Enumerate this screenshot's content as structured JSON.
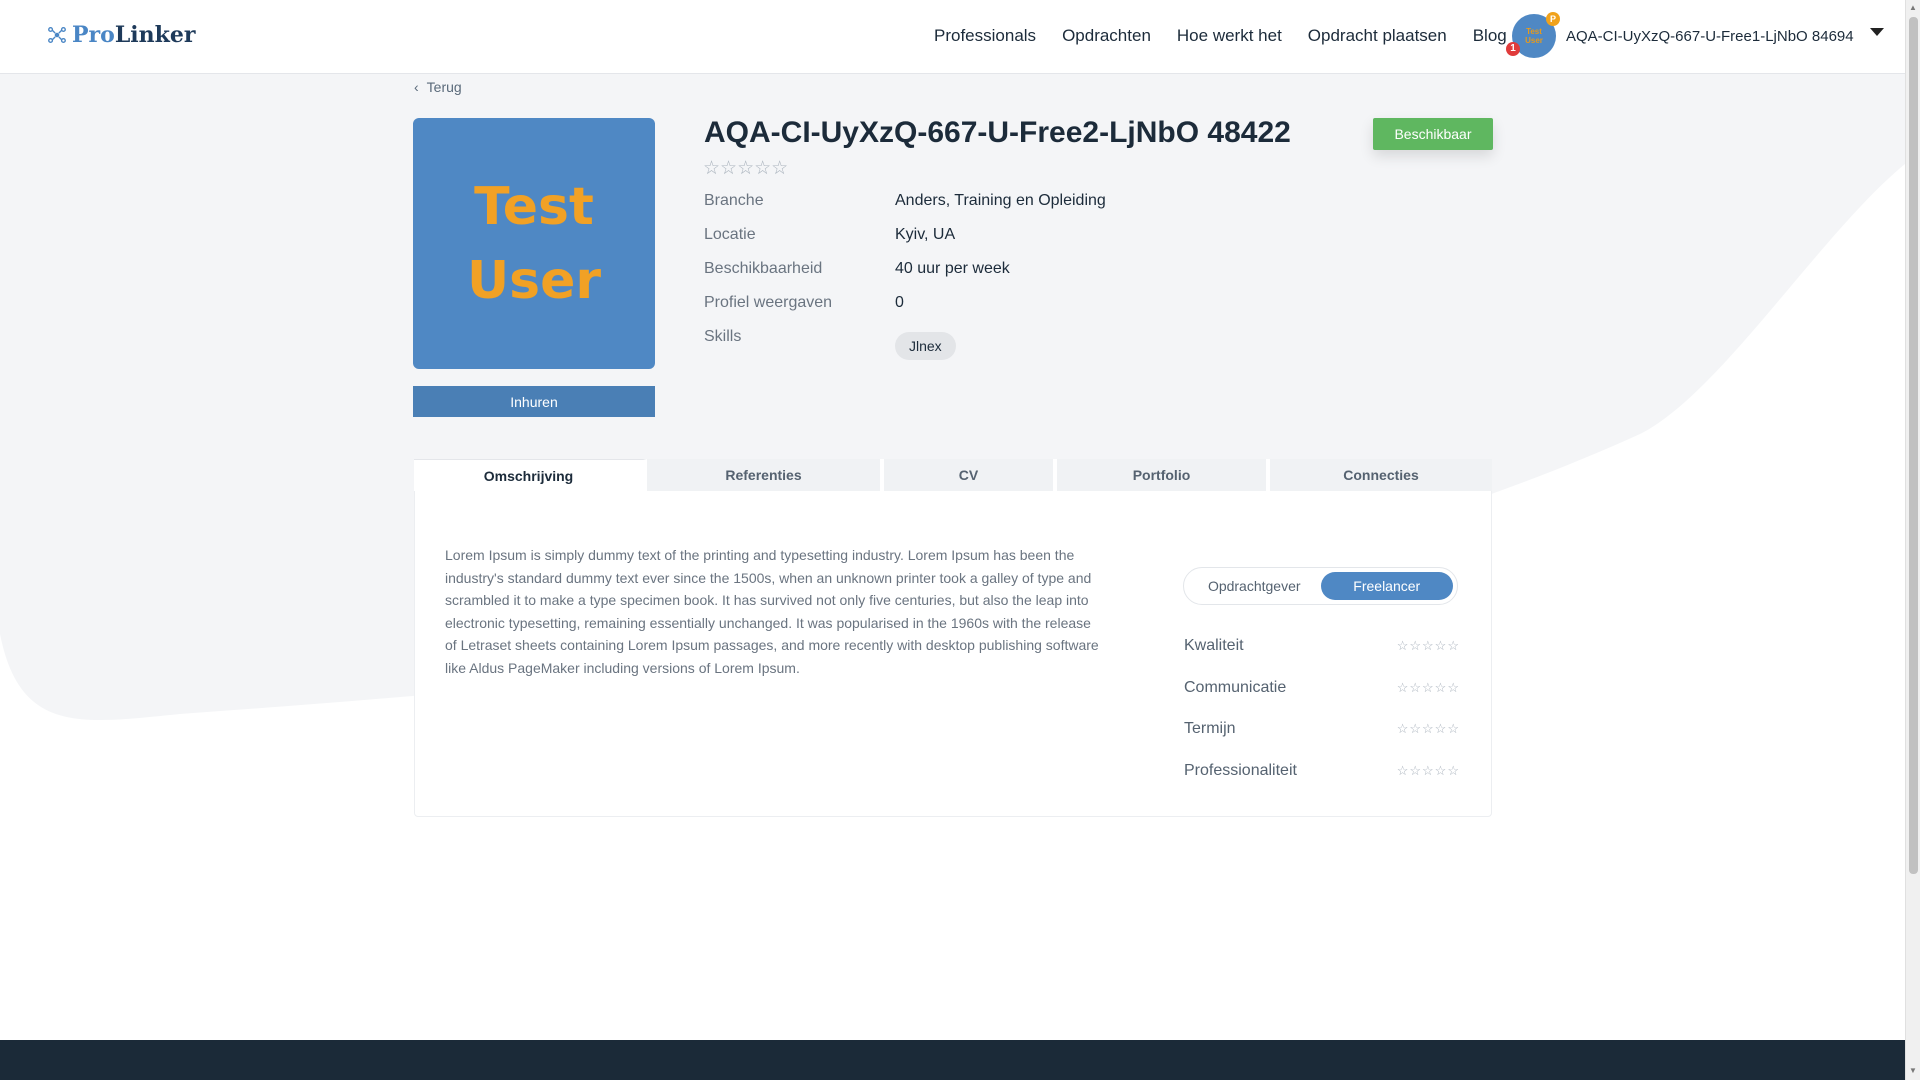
{
  "header": {
    "logo_pro": "Pro",
    "logo_linker": "Linker",
    "nav": [
      "Professionals",
      "Opdrachten",
      "Hoe werkt het",
      "Opdracht plaatsen",
      "Blog"
    ],
    "user_name": "AQA-CI-UyXzQ-667-U-Free1-LjNbO 84694",
    "notification_count": "1",
    "badge_letter": "P"
  },
  "back_label": "Terug",
  "profile": {
    "photo_line1": "Test",
    "photo_line2": "User",
    "hire_label": "Inhuren",
    "name": "AQA-CI-UyXzQ-667-U-Free2-LjNbO 48422",
    "status": "Beschikbaar",
    "rating": 0,
    "info": [
      {
        "label": "Branche",
        "value": "Anders, Training en Opleiding"
      },
      {
        "label": "Locatie",
        "value": "Kyiv, UA"
      },
      {
        "label": "Beschikbaarheid",
        "value": "40 uur per week"
      },
      {
        "label": "Profiel weergaven",
        "value": "0"
      }
    ],
    "skills_label": "Skills",
    "skills": [
      "Jlnex"
    ]
  },
  "tabs": [
    "Omschrijving",
    "Referenties",
    "CV",
    "Portfolio",
    "Connecties"
  ],
  "description": "Lorem Ipsum is simply dummy text of the printing and typesetting industry. Lorem Ipsum has been the industry's standard dummy text ever since the 1500s, when an unknown printer took a galley of type and scrambled it to make a type specimen book. It has survived not only five centuries, but also the leap into electronic typesetting, remaining essentially unchanged. It was popularised in the 1960s with the release of Letraset sheets containing Lorem Ipsum passages, and more recently with desktop publishing software like Aldus PageMaker including versions of Lorem Ipsum.",
  "toggle": {
    "option1": "Opdrachtgever",
    "option2": "Freelancer"
  },
  "ratings": [
    {
      "label": "Kwaliteit",
      "stars": 0
    },
    {
      "label": "Communicatie",
      "stars": 0
    },
    {
      "label": "Termijn",
      "stars": 0
    },
    {
      "label": "Professionaliteit",
      "stars": 0
    }
  ],
  "colors": {
    "accent": "#4f88c4",
    "available": "#5fb760",
    "footer": "#1b2a38"
  }
}
